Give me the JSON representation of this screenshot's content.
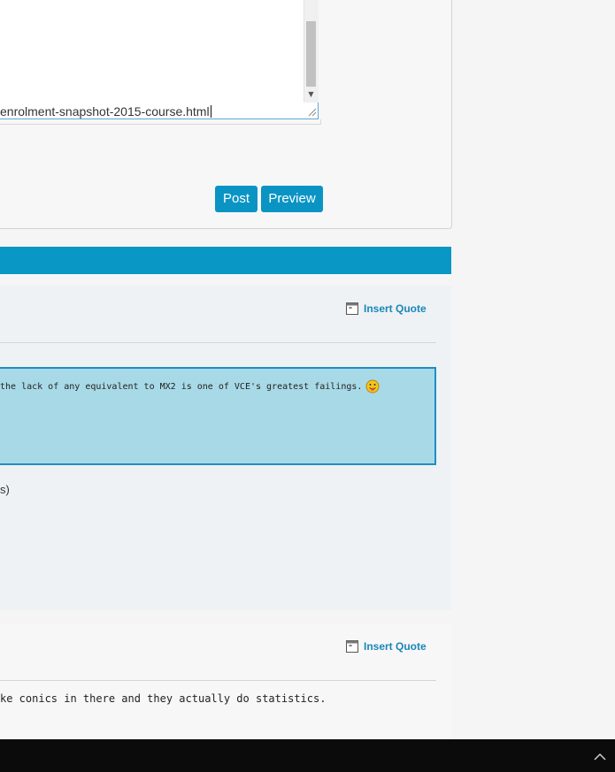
{
  "editor": {
    "text_line": "enrolment-snapshot-2015-course.html",
    "post_label": "Post",
    "preview_label": "Preview"
  },
  "post1": {
    "insert_quote_label": "Insert Quote",
    "quote_text": "the lack of any equivalent to MX2 is one of VCE's greatest failings.",
    "fragment_text": "s)"
  },
  "post2": {
    "insert_quote_label": "Insert Quote",
    "body_text": "ke conics in there and they actually do statistics."
  },
  "colors": {
    "accent": "#0997c6",
    "button": "#0a94c4",
    "quote_bg": "#a8d9e7",
    "quote_border": "#1f8fc1",
    "link": "#1a86b8"
  },
  "icons": [
    "insert-quote-icon",
    "tongue-smiley-icon",
    "scroll-down-arrow-icon",
    "resize-grip-icon",
    "chevron-up-icon"
  ]
}
